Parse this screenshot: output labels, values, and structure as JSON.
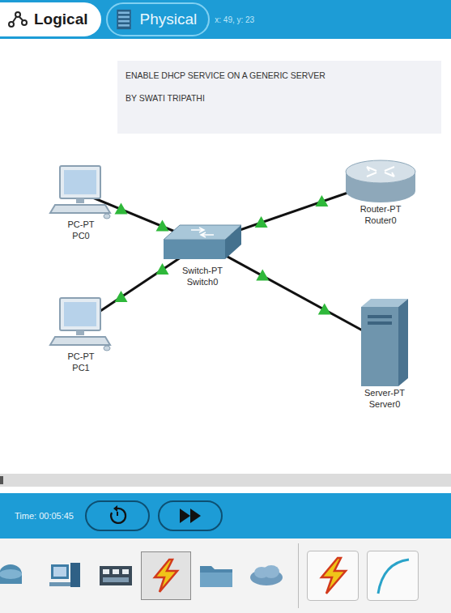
{
  "tabs": [
    {
      "label": "Logical",
      "kind": "logical",
      "selected": true
    },
    {
      "label": "Physical",
      "kind": "physical",
      "selected": false
    }
  ],
  "cursor": "x: 49, y: 23",
  "note": [
    "ENABLE DHCP SERVICE ON A GENERIC SERVER",
    "BY SWATI TRIPATHI"
  ],
  "devices": [
    {
      "kind": "pc",
      "model": "PC-PT",
      "name": "PC0"
    },
    {
      "kind": "pc",
      "model": "PC-PT",
      "name": "PC1"
    },
    {
      "kind": "switch",
      "model": "Switch-PT",
      "name": "Switch0"
    },
    {
      "kind": "router",
      "model": "Router-PT",
      "name": "Router0"
    },
    {
      "kind": "server",
      "model": "Server-PT",
      "name": "Server0"
    }
  ],
  "links": [
    {
      "from": "PC0",
      "to": "Switch0",
      "up": true
    },
    {
      "from": "PC1",
      "to": "Switch0",
      "up": true
    },
    {
      "from": "Switch0",
      "to": "Router0",
      "up": true
    },
    {
      "from": "Switch0",
      "to": "Server0",
      "up": true
    }
  ],
  "time": "Time: 00:05:45",
  "sim_buttons": [
    {
      "kind": "reset"
    },
    {
      "kind": "fast-forward"
    }
  ],
  "categories": [
    {
      "kind": "routers",
      "selected": false
    },
    {
      "kind": "devices",
      "selected": false
    },
    {
      "kind": "components",
      "selected": false
    },
    {
      "kind": "connections",
      "selected": true
    },
    {
      "kind": "folder",
      "selected": false
    },
    {
      "kind": "cloud",
      "selected": false
    }
  ],
  "subtypes": [
    {
      "kind": "lightning",
      "selected": false
    },
    {
      "kind": "cable",
      "selected": false
    }
  ]
}
